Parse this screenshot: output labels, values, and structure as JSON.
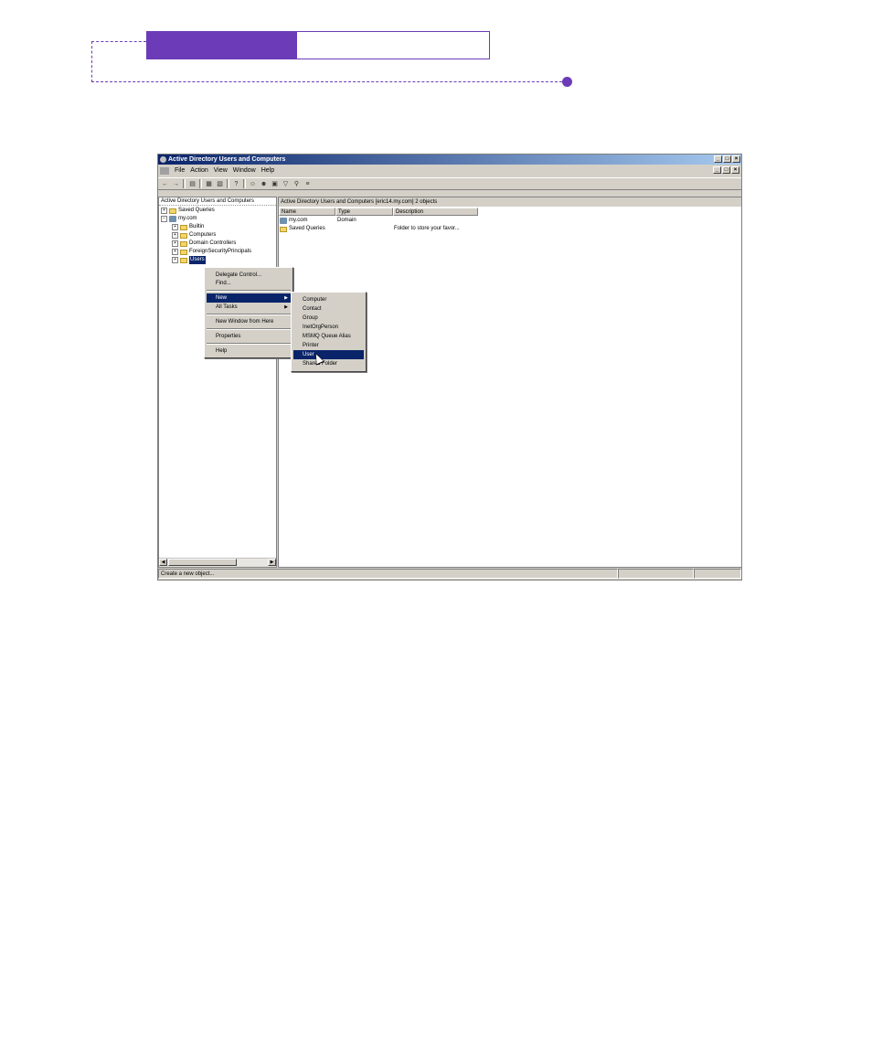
{
  "window": {
    "title": "Active Directory Users and Computers",
    "controls": [
      "_",
      "□",
      "×"
    ],
    "mdi_controls": [
      "_",
      "□",
      "×"
    ]
  },
  "menubar": [
    "File",
    "Action",
    "View",
    "Window",
    "Help"
  ],
  "tree": {
    "root": "Active Directory Users and Computers",
    "nodes": [
      {
        "label": "Saved Queries",
        "expander": "+"
      },
      {
        "label": "my.com",
        "expander": "−"
      },
      {
        "label": "Builtin",
        "expander": "+"
      },
      {
        "label": "Computers",
        "expander": "+"
      },
      {
        "label": "Domain Controllers",
        "expander": "+"
      },
      {
        "label": "ForeignSecurityPrincipals",
        "expander": "+"
      },
      {
        "label": "Users",
        "expander": "+"
      }
    ]
  },
  "list": {
    "header": "Active Directory Users and Computers [eric14.my.com]   2 objects",
    "columns": [
      "Name",
      "Type",
      "Description"
    ],
    "rows": [
      {
        "name": "my.com",
        "type": "Domain",
        "description": ""
      },
      {
        "name": "Saved Queries",
        "type": "",
        "description": "Folder to store your favor..."
      }
    ]
  },
  "context_menu": {
    "items": [
      "Delegate Control...",
      "Find...",
      "New",
      "All Tasks",
      "New Window from Here",
      "Properties",
      "Help"
    ]
  },
  "new_submenu": {
    "items": [
      "Computer",
      "Contact",
      "Group",
      "InetOrgPerson",
      "MSMQ Queue Alias",
      "Printer",
      "User",
      "Shared Folder"
    ],
    "highlighted": "User"
  },
  "statusbar": {
    "text": "Create a new object..."
  },
  "colors": {
    "accent": "#6b3bb8",
    "selection": "#0a246a",
    "chrome": "#d4d0c8"
  }
}
